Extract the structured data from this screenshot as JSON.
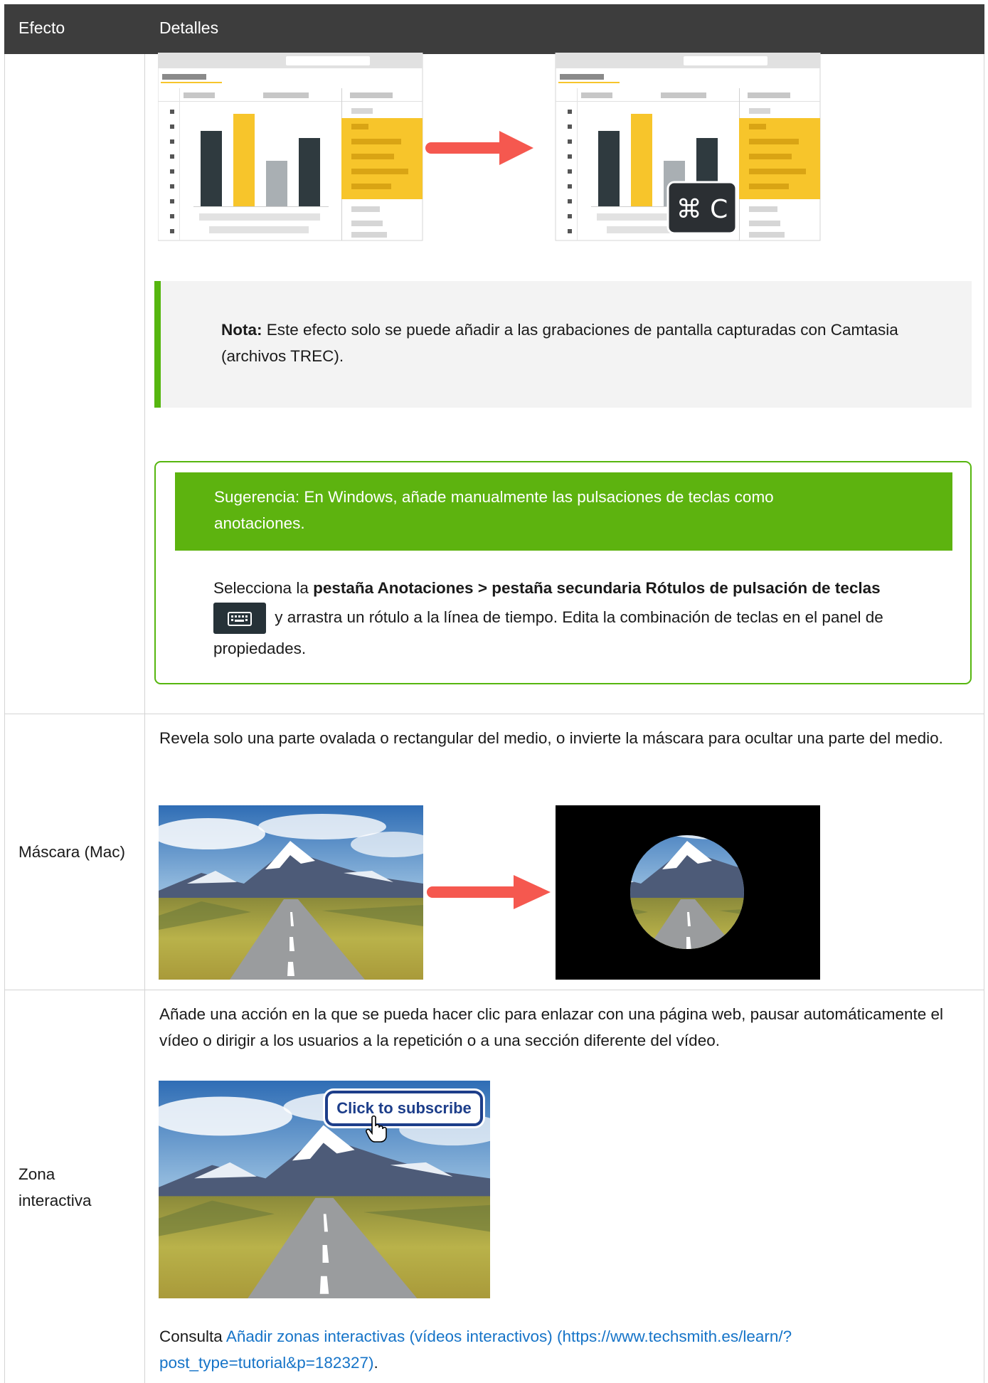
{
  "header": {
    "col_effect": "Efecto",
    "col_details": "Detalles"
  },
  "row1": {
    "shortcut_badge": "⌘ C",
    "note": {
      "label": "Nota:",
      "text": " Este efecto solo se puede añadir a las grabaciones de pantalla capturadas con Camtasia (archivos TREC)."
    },
    "tip": {
      "title": "Sugerencia: En Windows, añade manualmente las pulsaciones de teclas como anotaciones.",
      "body_pre": "Selecciona la ",
      "body_bold": "pestaña Anotaciones > pestaña secundaria Rótulos de pulsación de teclas",
      "body_post": " y arrastra un rótulo a la línea de tiempo. Edita la combinación de teclas en el panel de propiedades."
    }
  },
  "row2": {
    "effect": "Máscara (Mac)",
    "description": "Revela solo una parte ovalada o rectangular del medio, o invierte la máscara para ocultar una parte del medio."
  },
  "row3": {
    "effect": "Zona interactiva",
    "description": "Añade una acción en la que se pueda hacer clic para enlazar con una página web, pausar automáticamente el vídeo o dirigir a los usuarios a la repetición o a una sección diferente del vídeo.",
    "button_text": "Click to subscribe",
    "see_prefix": "Consulta ",
    "link_text": "Añadir zonas interactivas (vídeos interactivos) (https://www.techsmith.es/learn/?post_type=tutorial&p=182327)",
    "see_suffix": "."
  },
  "colors": {
    "header_bg": "#3d3d3d",
    "accent_green": "#5db30f",
    "arrow_red": "#f5584f",
    "link_blue": "#1674c8",
    "bar_yellow": "#f7c52b",
    "bar_dark": "#2f3a3f"
  }
}
